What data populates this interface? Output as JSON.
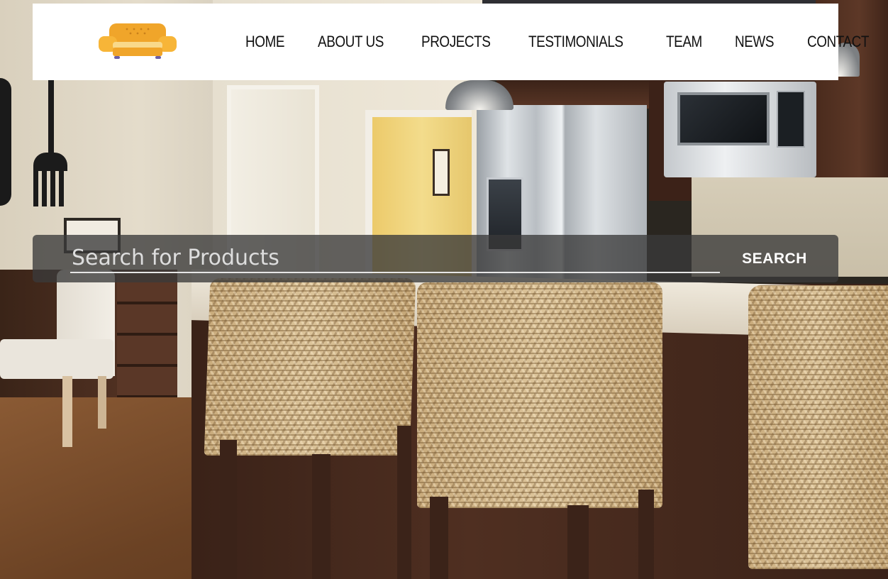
{
  "header": {
    "logo_icon": "armchair-icon",
    "nav": [
      {
        "label": "HOME"
      },
      {
        "label": "ABOUT US"
      },
      {
        "label": "PROJECTS"
      },
      {
        "label": "TESTIMONIALS"
      },
      {
        "label": "TEAM"
      },
      {
        "label": "NEWS"
      },
      {
        "label": "CONTACT"
      }
    ]
  },
  "search": {
    "placeholder": "Search for Products",
    "value": "",
    "button_label": "SEARCH"
  },
  "colors": {
    "header_bg": "#ffffff",
    "logo_primary": "#f0a52a",
    "logo_secondary": "#f7c34d",
    "nav_text": "#111111",
    "search_overlay": "#3a3a3a",
    "search_text": "#ffffff"
  }
}
